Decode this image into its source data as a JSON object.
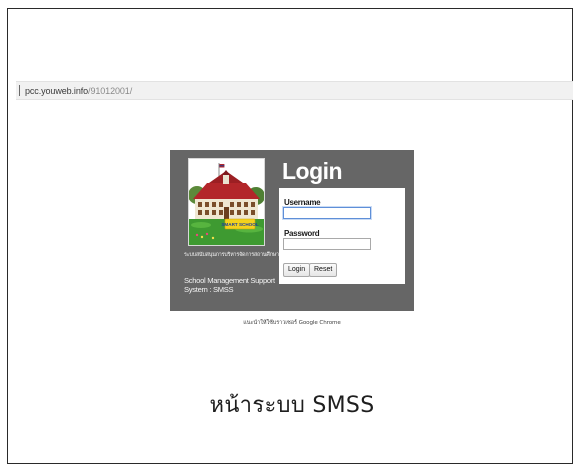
{
  "address_bar": {
    "host": "pcc.youweb.info",
    "path": "/91012001/"
  },
  "login_panel": {
    "title": "Login",
    "school_image": {
      "icon": "school-building-icon",
      "sign_text": "SMART SCHOOL"
    },
    "thai_caption": "ระบบสนับสนุนการบริหารจัดการสถานศึกษา",
    "system_name": "School Management Support System : SMSS",
    "username": {
      "label": "Username",
      "value": ""
    },
    "password": {
      "label": "Password",
      "value": ""
    },
    "login_button": "Login",
    "reset_button": "Reset"
  },
  "browser_hint": "แนะนำให้ใช้บราวเซอร์ Google Chrome",
  "caption": "หน้าระบบ SMSS",
  "colors": {
    "panel_bg": "#666666",
    "form_bg": "#ffffff",
    "focus_border": "#5f8fd8",
    "roof_red": "#b3262a",
    "grass_green": "#3e9a31",
    "sign_yellow": "#f4d21c"
  }
}
